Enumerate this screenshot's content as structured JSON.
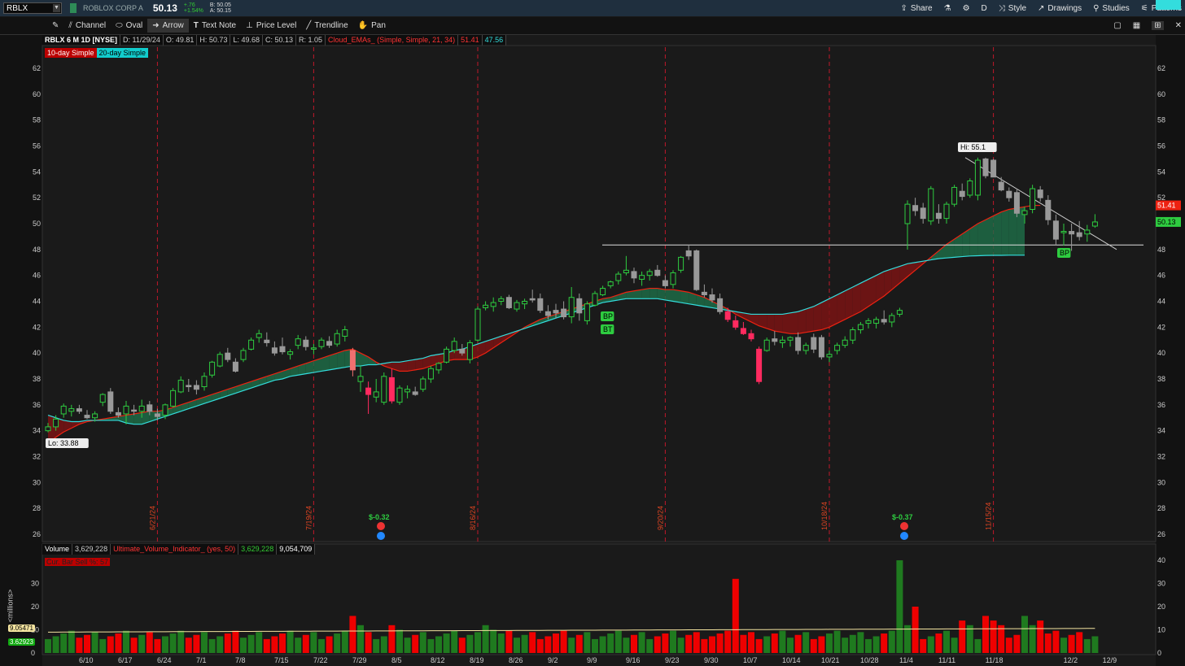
{
  "topbar": {
    "symbol": "RBLX",
    "company": "ROBLOX CORP A",
    "last": "50.13",
    "change_abs": "+.76",
    "change_pct": "+1.54%",
    "bid": "B: 50.05",
    "ask": "A: 50.15",
    "share": "Share",
    "period": "D",
    "style": "Style",
    "drawings": "Drawings",
    "studies": "Studies",
    "patterns": "Patterns"
  },
  "toolbar": {
    "channel": "Channel",
    "oval": "Oval",
    "arrow": "Arrow",
    "text_note": "Text Note",
    "price_level": "Price Level",
    "trendline": "Trendline",
    "pan": "Pan"
  },
  "header": {
    "title": "RBLX 6 M 1D [NYSE]",
    "date": "D: 11/29/24",
    "open": "O: 49.81",
    "high": "H: 50.73",
    "low": "L: 49.68",
    "close": "C: 50.13",
    "range": "R: 1.05",
    "cloud": "Cloud_EMAs_ (Simple, Simple, 21, 34)",
    "cloud_v1": "51.41",
    "cloud_v2": "47.56"
  },
  "legend": {
    "ma10": "10-day Simple",
    "ma20": "20-day Simple"
  },
  "price_axis": [
    "62",
    "60",
    "58",
    "56",
    "54",
    "52",
    "50",
    "48",
    "46",
    "44",
    "42",
    "40",
    "38",
    "36",
    "34",
    "32",
    "30",
    "28",
    "26"
  ],
  "price_tags": {
    "red": "51.41",
    "green": "50.13",
    "cyan": "47.56"
  },
  "annotations": {
    "hi": "Hi: 55.1",
    "lo": "Lo: 33.88",
    "bp1": "BP",
    "bt": "BT",
    "bp2": "BP",
    "earn1": "$-0.32",
    "earn2": "$-0.37"
  },
  "event_dates": [
    "6/21/24",
    "7/19/24",
    "8/16/24",
    "9/20/24",
    "10/18/24",
    "11/15/24"
  ],
  "x_axis": [
    "6/10",
    "6/17",
    "6/24",
    "7/1",
    "7/8",
    "7/15",
    "7/22",
    "7/29",
    "8/5",
    "8/12",
    "8/19",
    "8/26",
    "9/2",
    "9/9",
    "9/16",
    "9/23",
    "9/30",
    "10/7",
    "10/14",
    "10/21",
    "10/28",
    "11/4",
    "11/11",
    "11/18",
    "12/2",
    "12/9"
  ],
  "volume": {
    "label": "Volume",
    "value": "3,629,228",
    "indicator": "Ultimate_Volume_Indicator_ (yes, 50)",
    "v1": "3,629,228",
    "v2": "9,054,709",
    "cut": "Cur. Bar Sell %: 57",
    "axis": [
      "40",
      "30",
      "20",
      "10",
      "0"
    ],
    "left_axis": [
      "30",
      "20",
      "10",
      "0"
    ],
    "tag_avg": "9.05471",
    "tag_cur": "3.62923",
    "unit": "<millions>"
  },
  "chart_data": {
    "type": "candlestick",
    "ylim": [
      25,
      63
    ],
    "candles": [
      [
        34.0,
        34.6,
        33.88,
        34.3
      ],
      [
        34.3,
        35.2,
        34.0,
        34.9
      ],
      [
        35.3,
        36.1,
        35.0,
        35.9
      ],
      [
        35.5,
        36.0,
        35.1,
        35.7
      ],
      [
        35.7,
        36.0,
        35.3,
        35.5
      ],
      [
        35.2,
        35.6,
        34.9,
        35.0
      ],
      [
        35.0,
        35.5,
        34.7,
        35.3
      ],
      [
        36.2,
        36.9,
        35.9,
        36.8
      ],
      [
        37.0,
        37.3,
        35.3,
        35.5
      ],
      [
        35.4,
        35.8,
        35.0,
        35.2
      ],
      [
        35.3,
        36.3,
        34.5,
        35.9
      ],
      [
        35.6,
        36.0,
        35.2,
        35.5
      ],
      [
        35.5,
        36.4,
        35.0,
        35.9
      ],
      [
        36.0,
        36.3,
        35.2,
        35.5
      ],
      [
        35.3,
        35.7,
        34.8,
        35.1
      ],
      [
        35.2,
        36.1,
        34.9,
        36.0
      ],
      [
        35.9,
        37.3,
        35.8,
        37.1
      ],
      [
        37.0,
        38.2,
        36.9,
        37.9
      ],
      [
        37.5,
        38.0,
        37.0,
        37.4
      ],
      [
        37.5,
        37.9,
        36.8,
        37.2
      ],
      [
        37.4,
        38.5,
        37.1,
        38.2
      ],
      [
        38.3,
        39.4,
        38.1,
        39.3
      ],
      [
        39.0,
        40.1,
        38.9,
        39.9
      ],
      [
        40.0,
        40.4,
        39.3,
        39.5
      ],
      [
        39.3,
        39.6,
        38.5,
        38.6
      ],
      [
        39.5,
        40.4,
        39.3,
        40.2
      ],
      [
        40.3,
        41.2,
        40.2,
        41.0
      ],
      [
        41.2,
        41.8,
        40.8,
        41.5
      ],
      [
        41.0,
        41.6,
        40.5,
        40.8
      ],
      [
        40.4,
        40.9,
        39.8,
        40.0
      ],
      [
        40.5,
        41.2,
        39.9,
        40.1
      ],
      [
        39.9,
        40.3,
        39.5,
        40.1
      ],
      [
        40.6,
        41.4,
        40.3,
        41.1
      ],
      [
        41.0,
        41.3,
        40.2,
        40.5
      ],
      [
        40.3,
        40.7,
        39.9,
        40.4
      ],
      [
        40.5,
        41.2,
        40.3,
        41.0
      ],
      [
        40.9,
        41.3,
        40.4,
        40.6
      ],
      [
        40.7,
        41.8,
        40.5,
        41.5
      ],
      [
        41.3,
        42.1,
        40.9,
        41.8
      ],
      [
        40.2,
        40.4,
        38.2,
        38.7
      ],
      [
        37.8,
        39.0,
        37.0,
        38.2
      ],
      [
        37.3,
        37.8,
        35.3,
        36.8
      ],
      [
        36.6,
        38.0,
        36.2,
        37.0
      ],
      [
        36.2,
        38.5,
        36.0,
        38.2
      ],
      [
        38.1,
        38.8,
        36.1,
        36.3
      ],
      [
        36.2,
        37.5,
        36.0,
        37.3
      ],
      [
        37.0,
        37.5,
        36.5,
        37.2
      ],
      [
        37.0,
        37.4,
        36.7,
        36.8
      ],
      [
        37.2,
        38.2,
        37.0,
        38.0
      ],
      [
        38.0,
        39.0,
        37.7,
        38.8
      ],
      [
        38.7,
        39.3,
        38.4,
        39.2
      ],
      [
        39.3,
        40.5,
        39.2,
        40.3
      ],
      [
        40.2,
        41.2,
        40.0,
        40.9
      ],
      [
        40.3,
        40.7,
        39.8,
        40.0
      ],
      [
        39.5,
        41.0,
        39.2,
        40.8
      ],
      [
        41.0,
        43.6,
        40.9,
        43.4
      ],
      [
        43.5,
        44.0,
        43.3,
        43.7
      ],
      [
        43.6,
        44.3,
        43.2,
        43.9
      ],
      [
        44.0,
        44.4,
        43.7,
        44.2
      ],
      [
        44.3,
        44.5,
        43.4,
        43.5
      ],
      [
        43.4,
        44.1,
        43.2,
        43.9
      ],
      [
        43.8,
        44.2,
        43.4,
        44.0
      ],
      [
        44.2,
        44.9,
        43.9,
        44.1
      ],
      [
        44.2,
        44.6,
        43.1,
        43.3
      ],
      [
        43.2,
        43.7,
        42.6,
        42.9
      ],
      [
        43.3,
        43.8,
        42.7,
        43.1
      ],
      [
        43.4,
        44.0,
        42.6,
        42.8
      ],
      [
        42.8,
        45.1,
        42.3,
        44.3
      ],
      [
        44.2,
        44.6,
        42.5,
        43.1
      ],
      [
        42.5,
        44.0,
        42.2,
        43.8
      ],
      [
        43.7,
        44.8,
        43.6,
        44.6
      ],
      [
        44.5,
        45.2,
        44.4,
        45.0
      ],
      [
        45.2,
        45.6,
        45.0,
        45.5
      ],
      [
        45.6,
        46.3,
        45.3,
        46.1
      ],
      [
        46.2,
        47.5,
        46.0,
        46.4
      ],
      [
        46.3,
        46.6,
        45.4,
        45.8
      ],
      [
        45.7,
        46.3,
        45.2,
        46.0
      ],
      [
        46.0,
        46.5,
        45.6,
        46.3
      ],
      [
        46.4,
        46.8,
        45.9,
        46.0
      ],
      [
        45.6,
        46.0,
        45.0,
        45.2
      ],
      [
        45.3,
        46.4,
        45.0,
        46.2
      ],
      [
        46.4,
        47.5,
        46.2,
        47.4
      ],
      [
        47.9,
        48.3,
        47.2,
        47.5
      ],
      [
        47.9,
        48.0,
        44.8,
        44.9
      ],
      [
        44.7,
        45.3,
        44.3,
        44.5
      ],
      [
        44.5,
        45.0,
        43.9,
        44.1
      ],
      [
        44.2,
        44.6,
        43.0,
        43.2
      ],
      [
        43.2,
        43.5,
        42.4,
        42.6
      ],
      [
        42.5,
        42.9,
        41.8,
        42.0
      ],
      [
        41.9,
        42.4,
        41.4,
        41.5
      ],
      [
        41.5,
        41.8,
        40.9,
        41.1
      ],
      [
        40.3,
        40.5,
        37.6,
        37.8
      ],
      [
        40.2,
        41.2,
        40.1,
        41.0
      ],
      [
        41.1,
        41.7,
        40.6,
        40.9
      ],
      [
        40.8,
        41.3,
        40.4,
        41.0
      ],
      [
        41.0,
        41.3,
        40.5,
        41.2
      ],
      [
        41.2,
        41.6,
        39.9,
        40.2
      ],
      [
        40.2,
        40.8,
        39.9,
        40.6
      ],
      [
        41.2,
        41.5,
        40.0,
        40.3
      ],
      [
        41.2,
        41.4,
        39.5,
        39.7
      ],
      [
        39.7,
        40.2,
        39.3,
        39.9
      ],
      [
        40.2,
        40.8,
        39.9,
        40.6
      ],
      [
        40.6,
        41.3,
        40.4,
        41.0
      ],
      [
        41.0,
        42.0,
        40.7,
        41.8
      ],
      [
        41.8,
        42.4,
        41.5,
        42.2
      ],
      [
        42.3,
        42.7,
        41.9,
        42.5
      ],
      [
        42.3,
        42.8,
        41.9,
        42.6
      ],
      [
        42.6,
        43.3,
        42.2,
        42.4
      ],
      [
        42.4,
        43.1,
        42.0,
        42.9
      ],
      [
        43.0,
        43.5,
        42.8,
        43.3
      ],
      [
        50.0,
        51.8,
        48.0,
        51.5
      ],
      [
        51.4,
        52.0,
        50.6,
        51.0
      ],
      [
        51.2,
        51.6,
        50.0,
        50.4
      ],
      [
        50.2,
        52.9,
        49.9,
        52.7
      ],
      [
        50.8,
        51.5,
        50.0,
        50.4
      ],
      [
        50.4,
        51.7,
        50.0,
        51.5
      ],
      [
        51.5,
        53.0,
        51.3,
        52.8
      ],
      [
        52.5,
        53.1,
        51.8,
        52.1
      ],
      [
        52.2,
        53.5,
        52.0,
        53.3
      ],
      [
        52.2,
        55.1,
        51.8,
        54.9
      ],
      [
        55.0,
        55.1,
        53.5,
        53.7
      ],
      [
        54.9,
        55.0,
        53.7,
        53.6
      ],
      [
        53.2,
        53.6,
        52.5,
        52.6
      ],
      [
        52.5,
        52.8,
        51.7,
        52.0
      ],
      [
        52.4,
        52.7,
        50.5,
        50.8
      ],
      [
        50.7,
        51.3,
        50.0,
        51.0
      ],
      [
        51.1,
        53.0,
        50.8,
        52.7
      ],
      [
        52.6,
        52.9,
        51.7,
        52.0
      ],
      [
        51.8,
        52.2,
        49.9,
        50.3
      ],
      [
        50.2,
        50.7,
        48.3,
        48.8
      ],
      [
        49.3,
        50.0,
        48.3,
        49.4
      ],
      [
        49.4,
        50.0,
        47.9,
        49.2
      ],
      [
        49.3,
        50.2,
        48.7,
        49.0
      ],
      [
        49.2,
        49.9,
        48.6,
        49.5
      ],
      [
        49.81,
        50.73,
        49.68,
        50.13
      ]
    ],
    "ma10": [
      33.0,
      33.5,
      33.9,
      34.2,
      34.5,
      34.7,
      34.8,
      34.9,
      35.0,
      35.1,
      35.2,
      35.3,
      35.4,
      35.5,
      35.5,
      35.6,
      35.8,
      36.0,
      36.2,
      36.4,
      36.6,
      36.8,
      37.0,
      37.2,
      37.4,
      37.6,
      37.8,
      38.0,
      38.2,
      38.4,
      38.6,
      38.8,
      39.0,
      39.2,
      39.4,
      39.6,
      39.8,
      40.0,
      40.2,
      40.3,
      40.0,
      39.7,
      39.3,
      39.0,
      38.8,
      38.6,
      38.6,
      38.7,
      38.8,
      39.0,
      39.2,
      39.4,
      39.5,
      39.5,
      39.5,
      39.7,
      40.0,
      40.4,
      40.8,
      41.2,
      41.6,
      42.0,
      42.3,
      42.6,
      42.8,
      43.0,
      43.2,
      43.4,
      43.6,
      43.8,
      44.0,
      44.2,
      44.3,
      44.5,
      44.7,
      44.8,
      44.9,
      45.0,
      45.0,
      44.9,
      44.9,
      44.8,
      44.7,
      44.5,
      44.3,
      44.0,
      43.7,
      43.4,
      43.0,
      42.7,
      42.4,
      42.1,
      41.9,
      41.7,
      41.6,
      41.5,
      41.5,
      41.6,
      41.7,
      41.8,
      42.0,
      42.3,
      42.6,
      42.9,
      43.2,
      43.6,
      44.0,
      44.4,
      44.9,
      45.4,
      45.9,
      46.4,
      46.9,
      47.4,
      47.9,
      48.4,
      48.8,
      49.2,
      49.6,
      50.0,
      50.3,
      50.6,
      50.9,
      51.1,
      51.2,
      51.3,
      51.4,
      51.41
    ],
    "ma20": [
      35.2,
      35.0,
      34.8,
      34.7,
      34.7,
      34.8,
      34.8,
      34.8,
      34.8,
      34.8,
      34.6,
      34.5,
      34.5,
      34.7,
      34.9,
      35.1,
      35.3,
      35.5,
      35.7,
      35.9,
      36.1,
      36.3,
      36.5,
      36.7,
      36.9,
      37.1,
      37.3,
      37.5,
      37.7,
      37.9,
      38.0,
      38.2,
      38.3,
      38.4,
      38.5,
      38.6,
      38.7,
      38.8,
      38.9,
      39.0,
      39.0,
      39.1,
      39.1,
      39.2,
      39.3,
      39.3,
      39.4,
      39.5,
      39.6,
      39.8,
      39.9,
      40.0,
      40.2,
      40.3,
      40.5,
      40.7,
      40.9,
      41.1,
      41.3,
      41.5,
      41.7,
      41.9,
      42.1,
      42.3,
      42.5,
      42.7,
      42.9,
      43.1,
      43.3,
      43.5,
      43.7,
      43.9,
      44.0,
      44.1,
      44.2,
      44.2,
      44.2,
      44.2,
      44.2,
      44.1,
      44.0,
      43.9,
      43.8,
      43.7,
      43.6,
      43.5,
      43.4,
      43.3,
      43.2,
      43.1,
      43.0,
      43.0,
      43.0,
      43.0,
      43.0,
      43.1,
      43.2,
      43.4,
      43.6,
      43.9,
      44.2,
      44.5,
      44.8,
      45.1,
      45.4,
      45.7,
      46.0,
      46.3,
      46.5,
      46.7,
      46.9,
      47.0,
      47.1,
      47.2,
      47.3,
      47.35,
      47.4,
      47.45,
      47.5,
      47.52,
      47.54,
      47.55,
      47.55,
      47.56,
      47.56,
      47.56
    ]
  }
}
